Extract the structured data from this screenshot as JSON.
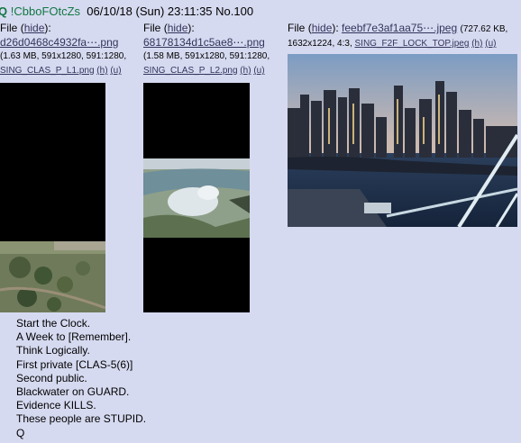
{
  "post": {
    "name": "Q",
    "tripcode": "!CbboFOtcZs",
    "datetime": "06/10/18 (Sun) 23:11:35",
    "number": "No.100"
  },
  "files": [
    {
      "label": "File",
      "hide": "hide",
      "filename": "d26d0468c4932fa⋯.png",
      "info": "(1.63 MB, 591x1280, 591:1280,",
      "orig_name": "SING_CLAS_P_L1.png",
      "h_link": "(h)",
      "u_link": "(u)"
    },
    {
      "label": "File",
      "hide": "hide",
      "filename": "68178134d1c5ae8⋯.png",
      "info": "(1.58 MB, 591x1280, 591:1280,",
      "orig_name": "SING_CLAS_P_L2.png",
      "h_link": "(h)",
      "u_link": "(u)"
    },
    {
      "label": "File",
      "hide": "hide",
      "filename": "feebf7e3af1aa75⋯.jpeg",
      "info": "(727.62 KB,",
      "info2": "1632x1224, 4:3,",
      "orig_name": "SING_F2F_LOCK_TOP.jpeg",
      "h_link": "(h)",
      "u_link": "(u)"
    }
  ],
  "message": [
    "Start the Clock.",
    "A Week to [Remember].",
    "Think Logically.",
    "First private [CLAS-5(6)]",
    "Second public.",
    "Blackwater on GUARD.",
    "Evidence KILLS.",
    "These people are STUPID.",
    "Q"
  ]
}
